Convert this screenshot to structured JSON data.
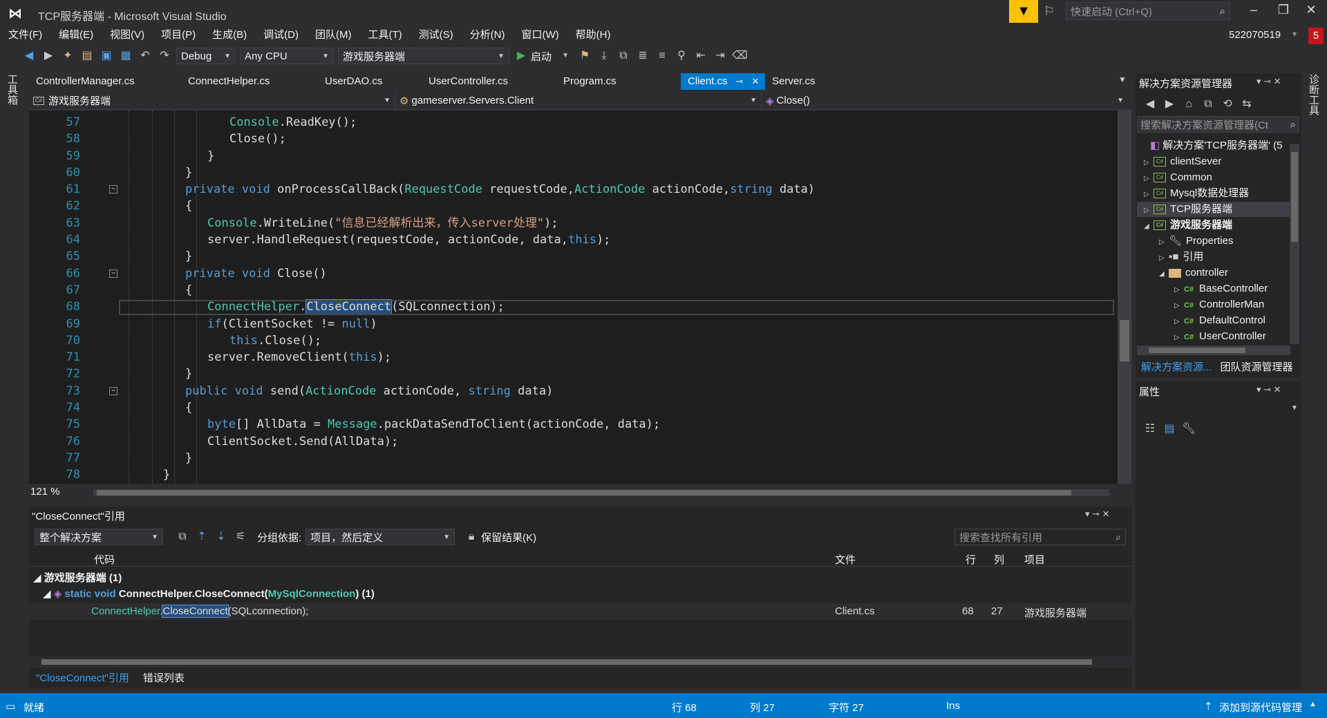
{
  "window": {
    "title": "TCP服务器端 - Microsoft Visual Studio",
    "quick_launch_placeholder": "快速启动 (Ctrl+Q)",
    "account": "522070519",
    "notification_count": "5"
  },
  "menu": [
    "文件(F)",
    "编辑(E)",
    "视图(V)",
    "项目(P)",
    "生成(B)",
    "调试(D)",
    "团队(M)",
    "工具(T)",
    "测试(S)",
    "分析(N)",
    "窗口(W)",
    "帮助(H)"
  ],
  "toolbar": {
    "config": "Debug",
    "platform": "Any CPU",
    "startup_project": "游戏服务器端",
    "start_label": "启动"
  },
  "side_labels": {
    "toolbox": "工具箱",
    "diagnostics": "诊断工具"
  },
  "tabs": [
    "ControllerManager.cs",
    "ConnectHelper.cs",
    "UserDAO.cs",
    "UserController.cs",
    "Program.cs",
    "Client.cs",
    "Server.cs"
  ],
  "active_tab": "Client.cs",
  "navbar": {
    "project": "游戏服务器端",
    "class": "gameserver.Servers.Client",
    "member": "Close()"
  },
  "code": {
    "line_numbers": [
      "57",
      "58",
      "59",
      "60",
      "61",
      "62",
      "63",
      "64",
      "65",
      "66",
      "67",
      "68",
      "69",
      "70",
      "71",
      "72",
      "73",
      "74",
      "75",
      "76",
      "77",
      "78"
    ],
    "l57a": "Console",
    "l57b": ".ReadKey();",
    "l58": "Close();",
    "brace_close": "}",
    "brace_open": "{",
    "private": "private",
    "void": "void",
    "public": "public",
    "string": "string",
    "this": "this",
    "null": "null",
    "if": "if",
    "byte": "byte",
    "l61_name": "onProcessCallBack(",
    "l61_rc_type": "RequestCode",
    "l61_rc_name": " requestCode,",
    "l61_ac_type": "ActionCode",
    "l61_ac_name": " actionCode,",
    "l61_data": " data)",
    "l63_console": "Console",
    "l63_writeline": ".WriteLine(",
    "l63_str": "\"信息已经解析出来，传入server处理\"",
    "l63_end": ");",
    "l64_a": "server.HandleRequest(requestCode, actionCode, data,",
    "l64_end": ");",
    "l66_name": "Close()",
    "l68_type": "ConnectHelper",
    "l68_dot": ".",
    "l68_method": "CloseConnect",
    "l68_end": "(SQLconnection);",
    "l69_a": "(ClientSocket != ",
    "l69_end": ")",
    "l70_end": ".Close();",
    "l71_a": "server.RemoveClient(",
    "l71_end": ");",
    "l73_name": "send(",
    "l73_ac": "ActionCode",
    "l73_rest": " actionCode, ",
    "l73_data": " data)",
    "l75_a": "[] AllData = ",
    "l75_msg": "Message",
    "l75_end": ".packDataSendToClient(actionCode, data);",
    "l76": "ClientSocket.Send(AllData);"
  },
  "zoom": "121 %",
  "references": {
    "title": "\"CloseConnect\"引用",
    "scope": "整个解决方案",
    "group_by_label": "分组依据:",
    "group_by_value": "项目，然后定义",
    "keep_results": "保留结果(K)",
    "search_placeholder": "搜索查找所有引用",
    "columns": {
      "code": "代码",
      "file": "文件",
      "line": "行",
      "col": "列",
      "project": "项目"
    },
    "group": "游戏服务器端 (1)",
    "definition": {
      "static": "static",
      "void": "void",
      "class": "ConnectHelper",
      "method": ".CloseConnect(",
      "param": "MySqlConnection",
      "end": ") (1)"
    },
    "rows": [
      {
        "code_type": "ConnectHelper.",
        "code_method": "CloseConnect",
        "code_end": "(SQLconnection);",
        "file": "Client.cs",
        "line": "68",
        "col": "27",
        "project": "游戏服务器端"
      }
    ],
    "bottom_tabs": [
      "\"CloseConnect\"引用",
      "错误列表"
    ]
  },
  "solution_explorer": {
    "title": "解决方案资源管理器",
    "search_placeholder": "搜索解决方案资源管理器(Ct",
    "solution": "解决方案'TCP服务器端' (5",
    "items": [
      {
        "label": "clientSever"
      },
      {
        "label": "Common"
      },
      {
        "label": "Mysql数据处理器"
      },
      {
        "label": "TCP服务器端"
      },
      {
        "label": "游戏服务器端"
      },
      {
        "label": "Properties"
      },
      {
        "label": "引用"
      },
      {
        "label": "controller"
      },
      {
        "label": "BaseController"
      },
      {
        "label": "ControllerMan"
      },
      {
        "label": "DefaultControl"
      },
      {
        "label": "UserController"
      }
    ],
    "tabs": [
      "解决方案资源...",
      "团队资源管理器"
    ]
  },
  "properties": {
    "title": "属性"
  },
  "status": {
    "ready": "就绪",
    "line": "行 68",
    "col": "列 27",
    "char": "字符 27",
    "ins": "Ins",
    "source_control": "添加到源代码管理"
  }
}
